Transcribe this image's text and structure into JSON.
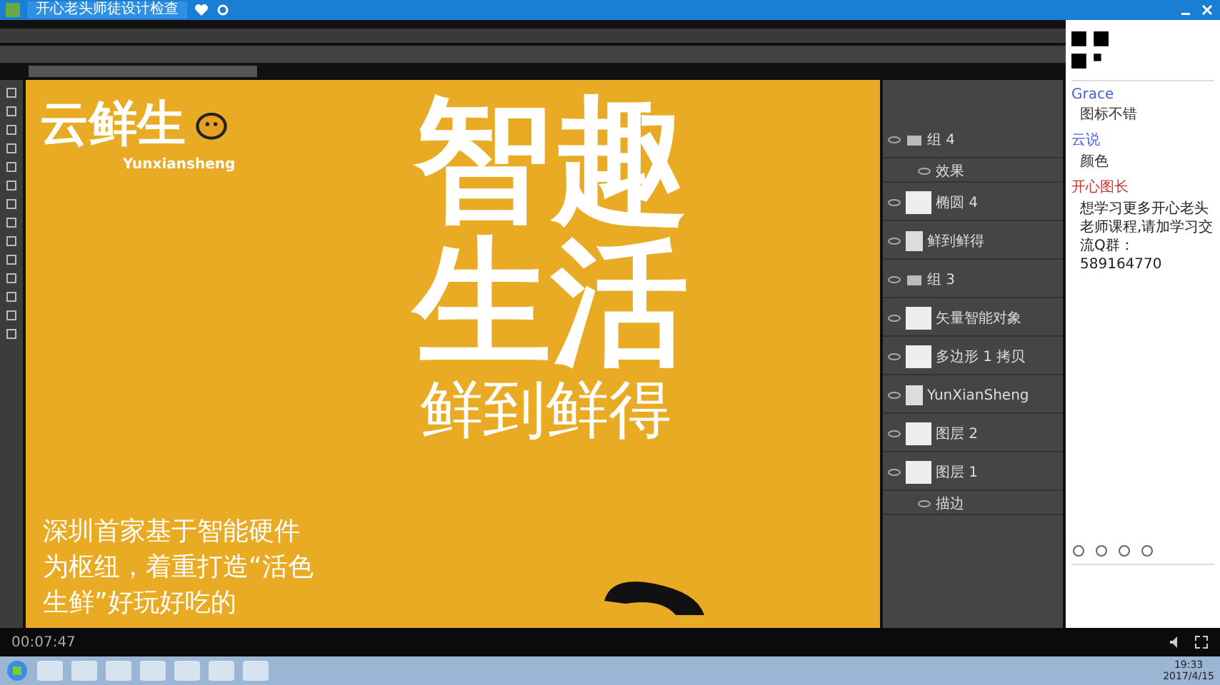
{
  "browser_tab": {
    "title": "开心老头师徒设计检查"
  },
  "canvas": {
    "logo": "云鲜生",
    "logo_caption": "Yunxiansheng",
    "headline_1": "智趣",
    "headline_2": "生活",
    "subtitle": "鲜到鲜得",
    "paragraph": "深圳首家基于智能硬件为枢纽，着重打造“活色生鲜”好玩好吃的"
  },
  "layers": [
    {
      "kind": "group",
      "name": "组 4"
    },
    {
      "kind": "effect",
      "name": "效果"
    },
    {
      "kind": "layer",
      "name": "椭圆 4"
    },
    {
      "kind": "text",
      "name": "鲜到鲜得"
    },
    {
      "kind": "group",
      "name": "组 3"
    },
    {
      "kind": "layer",
      "name": "矢量智能对象"
    },
    {
      "kind": "layer",
      "name": "多边形 1 拷贝"
    },
    {
      "kind": "text",
      "name": "YunXianSheng"
    },
    {
      "kind": "layer",
      "name": "图层 2"
    },
    {
      "kind": "layer",
      "name": "图层 1"
    },
    {
      "kind": "effect",
      "name": "描边"
    }
  ],
  "chat": [
    {
      "kind": "user",
      "name": "Grace",
      "message": "图标不错"
    },
    {
      "kind": "user",
      "name": "云说",
      "message": "颜色"
    },
    {
      "kind": "notice",
      "name": "开心图长",
      "message": "想学习更多开心老头老师课程,请加学习交流Q群：589164770"
    }
  ],
  "player": {
    "time": "00:07:47"
  },
  "taskbar": {
    "time": "19:33",
    "date": "2017/4/15"
  }
}
